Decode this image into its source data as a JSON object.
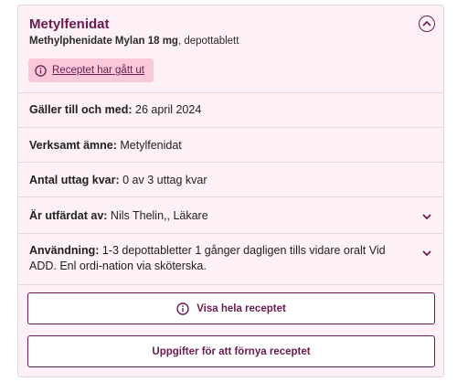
{
  "prescription": {
    "title": "Metylfenidat",
    "product_name": "Methylphenidate Mylan 18 mg",
    "product_form": ", depottablett",
    "alert_text": "Receptet har gått ut"
  },
  "details": [
    {
      "label": "Gäller till och med:",
      "value": " 26 april 2024"
    },
    {
      "label": "Verksamt ämne:",
      "value": " Metylfenidat"
    },
    {
      "label": "Antal uttag kvar:",
      "value": " 0 av 3 uttag kvar"
    },
    {
      "label": "Är utfärdat av:",
      "value": " Nils Thelin,, Läkare"
    },
    {
      "label": "Användning:",
      "value": " 1-3 depottabletter 1 gånger dagligen tills vidare oralt Vid ADD. Enl ordi-nation via sköterska."
    }
  ],
  "buttons": {
    "view_full": "Visa hela receptet",
    "renew_info": "Uppgifter för att förnya receptet"
  },
  "colors": {
    "accent": "#6b1a4f",
    "card_bg": "#fdf0f6",
    "alert_bg": "#f9c9d9"
  }
}
